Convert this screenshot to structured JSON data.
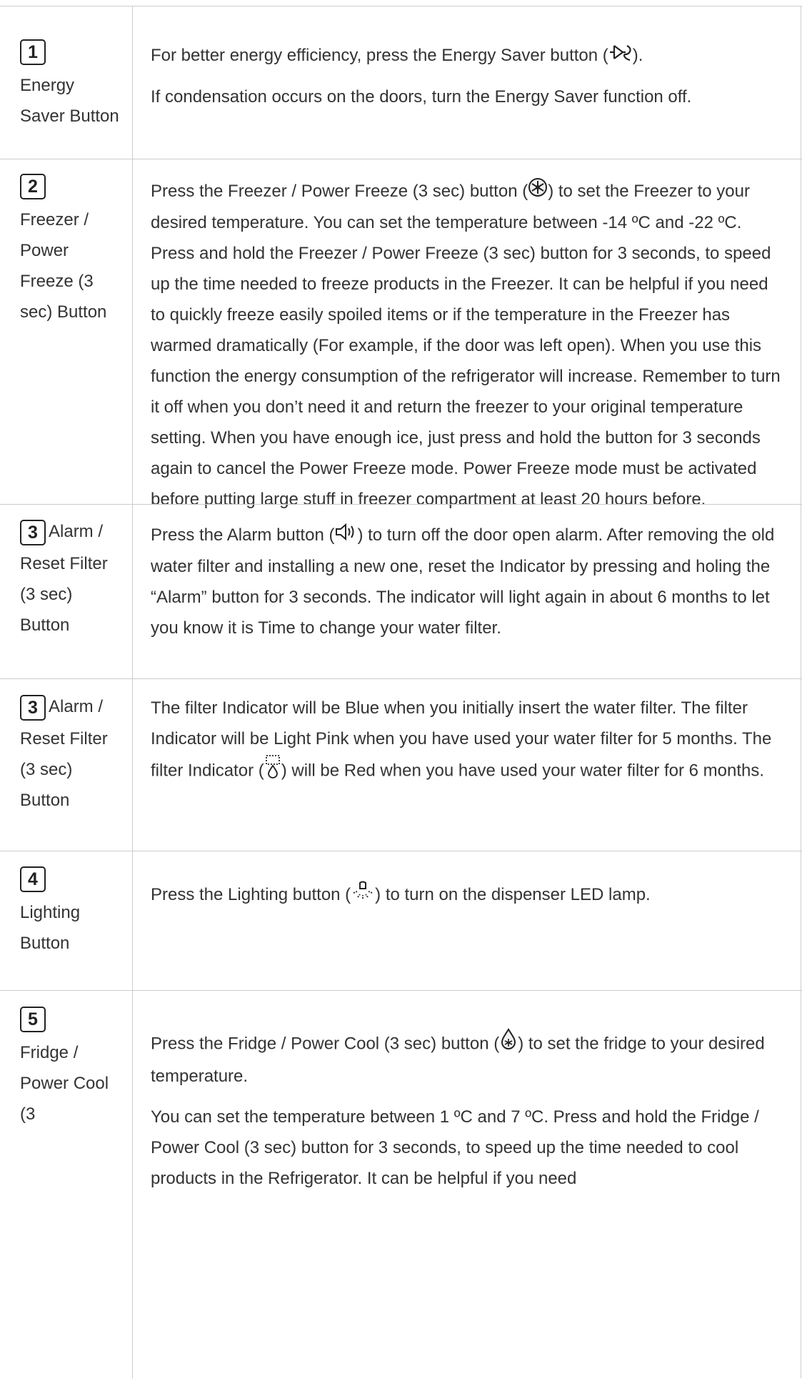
{
  "rows": [
    {
      "number": "1",
      "label": "Energy Saver Button",
      "paragraphs": [
        {
          "before": "For better energy efficiency, press the Energy Saver button (",
          "icon": "energy-saver-icon",
          "after": ")."
        },
        {
          "text": "If condensation occurs on the doors, turn the Energy Saver function off."
        }
      ]
    },
    {
      "number": "2",
      "label": "Freezer / Power Freeze (3 sec) Button",
      "paragraphs": [
        {
          "before": "Press the Freezer / Power Freeze (3 sec) button (",
          "icon": "freezer-icon",
          "after": ") to set the Freezer to your desired temperature. You can set the temperature between -14 ºC and -22 ºC. Press and hold the Freezer / Power Freeze (3 sec) button for 3 seconds, to speed up the time needed to freeze products in the Freezer. It can be helpful if you need to quickly freeze easily spoiled items or if the temperature in the Freezer has warmed dramatically (For example, if the door was left open). When you use this function the energy consumption of the refrigerator will increase. Remember to turn it off when you don’t need it and return the freezer to your original temperature setting. When you have enough ice, just press and hold the button for 3 seconds again to cancel the Power Freeze mode. Power Freeze mode must be activated before putting large stuff in freezer compartment at least 20 hours before."
        }
      ]
    },
    {
      "number": "3",
      "label": "Alarm / Reset Filter (3 sec) Button",
      "paragraphs": [
        {
          "before": "Press the Alarm button (",
          "icon": "alarm-icon",
          "after": ") to turn off the door open alarm. After removing the old water filter and installing a new one, reset the Indicator by pressing and holing the “Alarm” button for 3 seconds. The indicator will light again in about 6 months to let you know it is Time to change your water filter."
        }
      ]
    },
    {
      "number": "3",
      "label": "Alarm / Reset Filter (3 sec) Button",
      "paragraphs": [
        {
          "before": "The filter Indicator will be Blue when you initially insert the water filter. The filter Indicator will be Light Pink when you have used your water filter for 5 months. The filter Indicator (",
          "icon": "filter-indicator-icon",
          "after": ") will be Red when you have used your water filter for 6 months."
        }
      ]
    },
    {
      "number": "4",
      "label": "Lighting Button",
      "paragraphs": [
        {
          "before": "Press the Lighting button (",
          "icon": "lighting-icon",
          "after": ") to turn on the dispenser LED lamp."
        }
      ]
    },
    {
      "number": "5",
      "label": "Fridge / Power Cool (3",
      "paragraphs": [
        {
          "before": "Press the Fridge / Power Cool (3 sec) button (",
          "icon": "fridge-icon",
          "after": ") to set the fridge to your desired temperature."
        },
        {
          "text": "You can set the temperature between 1 ºC and 7 ºC. Press and hold the Fridge / Power Cool (3 sec) button for 3 seconds, to speed up the time needed to cool products in the Refrigerator. It can be helpful if you need"
        }
      ]
    }
  ]
}
